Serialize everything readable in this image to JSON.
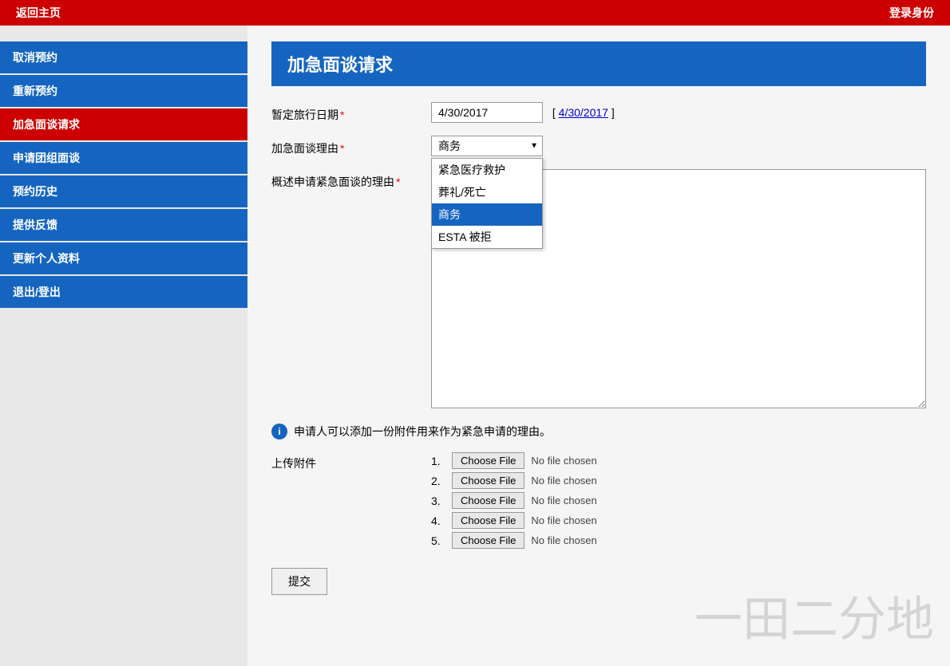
{
  "topbar": {
    "home_label": "返回主页",
    "login_label": "登录身份"
  },
  "sidebar": {
    "items": [
      {
        "id": "cancel-appointment",
        "label": "取消预约",
        "active": false
      },
      {
        "id": "reschedule",
        "label": "重新预约",
        "active": false
      },
      {
        "id": "emergency-request",
        "label": "加急面谈请求",
        "active": true
      },
      {
        "id": "group-interview",
        "label": "申请团组面谈",
        "active": false
      },
      {
        "id": "history",
        "label": "预约历史",
        "active": false
      },
      {
        "id": "feedback",
        "label": "提供反馈",
        "active": false
      },
      {
        "id": "update-profile",
        "label": "更新个人资料",
        "active": false
      },
      {
        "id": "logout",
        "label": "退出/登出",
        "active": false
      }
    ]
  },
  "page": {
    "title": "加急面谈请求",
    "fields": {
      "travel_date_label": "暂定旅行日期",
      "travel_date_value": "4/30/2017",
      "travel_date_link": "4/30/2017",
      "reason_label": "加急面谈理由",
      "description_label": "概述申请紧急面谈的理由",
      "info_text": "申请人可以添加一份附件用来作为紧急申请的理由。",
      "upload_label": "上传附件",
      "submit_label": "提交"
    },
    "dropdown": {
      "current_value": "商务",
      "options": [
        {
          "value": "urgent_medical",
          "label": "紧急医疗救护"
        },
        {
          "value": "funeral",
          "label": "葬礼/死亡"
        },
        {
          "value": "business",
          "label": "商务",
          "selected": true
        },
        {
          "value": "esta_denied",
          "label": "ESTA 被拒"
        }
      ]
    },
    "file_uploads": [
      {
        "number": "1.",
        "button_label": "Choose File",
        "chosen": "No file chosen"
      },
      {
        "number": "2.",
        "button_label": "Choose File",
        "chosen": "No file chosen"
      },
      {
        "number": "3.",
        "button_label": "Choose File",
        "chosen": "No file chosen"
      },
      {
        "number": "4.",
        "button_label": "Choose File",
        "chosen": "No file chosen"
      },
      {
        "number": "5.",
        "button_label": "Choose File",
        "chosen": "No file chosen"
      }
    ]
  }
}
